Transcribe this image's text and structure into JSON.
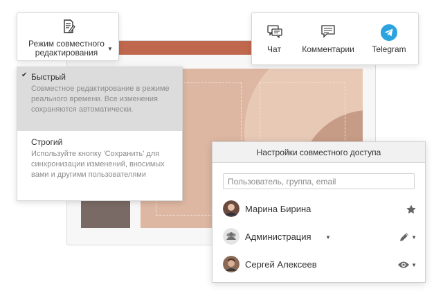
{
  "mode_card": {
    "label": "Режим совместного редактирования",
    "icon": "document-edit-icon"
  },
  "mode_dropdown": {
    "options": [
      {
        "title": "Быстрый",
        "description": "Совместное редактирование в режиме реального времени. Все изменения сохраняются автоматически.",
        "selected": true
      },
      {
        "title": "Строгий",
        "description": "Используйте кнопку 'Сохранить' для синхронизации изменений, вносимых вами и другими пользователями",
        "selected": false
      }
    ]
  },
  "toolbar": {
    "chat_label": "Чат",
    "comments_label": "Комментарии",
    "telegram_label": "Telegram"
  },
  "sharing": {
    "title": "Настройки совместного доступа",
    "search_placeholder": "Пользователь, группа, email",
    "entries": [
      {
        "name": "Марина Бирина",
        "permission_icon": "star-icon"
      },
      {
        "name": "Администрация",
        "permission_icon": "pencil-icon"
      },
      {
        "name": "Сергей Алексеев",
        "permission_icon": "eye-icon"
      }
    ]
  },
  "colors": {
    "accent_red": "#c0684e",
    "slide_bg": "#ddb7a2",
    "telegram_blue": "#2aa3df",
    "selected_bg": "#dcdcdc"
  }
}
